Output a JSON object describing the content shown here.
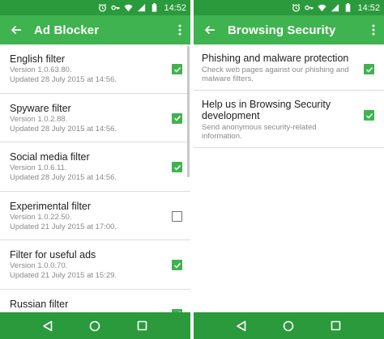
{
  "status_bar": {
    "time": "14:52"
  },
  "colors": {
    "status_bar": "#2b9a3c",
    "app_bar": "#3fb34f",
    "accent": "#3fb34f"
  },
  "left": {
    "title": "Ad Blocker",
    "filters": [
      {
        "name": "English filter",
        "version": "Version 1.0.63.80.",
        "updated": "Updated 28 July 2015 at 14:56.",
        "checked": true
      },
      {
        "name": "Spyware filter",
        "version": "Version 1.0.2.88.",
        "updated": "Updated 28 July 2015 at 14:56.",
        "checked": true
      },
      {
        "name": "Social media filter",
        "version": "Version 1.0.6.11.",
        "updated": "Updated 28 July 2015 at 14:56.",
        "checked": true
      },
      {
        "name": "Experimental filter",
        "version": "Version 1.0.22.50.",
        "updated": "Updated 21 July 2015 at 17:00.",
        "checked": false
      },
      {
        "name": "Filter for useful ads",
        "version": "Version 1.0.0.70.",
        "updated": "Updated 21 July 2015 at 15:29.",
        "checked": true
      },
      {
        "name": "Russian filter",
        "version": "",
        "updated": "",
        "checked": true
      }
    ]
  },
  "right": {
    "title": "Browsing Security",
    "options": [
      {
        "name": "Phishing and malware protection",
        "description": "Check web pages against our phishing and malware filters.",
        "checked": true
      },
      {
        "name": "Help us in Browsing Security development",
        "description": "Send anonymous security-related information.",
        "checked": true
      }
    ]
  },
  "icons": {
    "back": "arrow-left-icon",
    "menu": "more-vert-icon",
    "nav_back": "triangle-back-icon",
    "nav_home": "circle-home-icon",
    "nav_recents": "square-recents-icon",
    "status": [
      "alarm-icon",
      "key-icon",
      "wifi-icon",
      "signal-icon",
      "battery-icon"
    ]
  }
}
